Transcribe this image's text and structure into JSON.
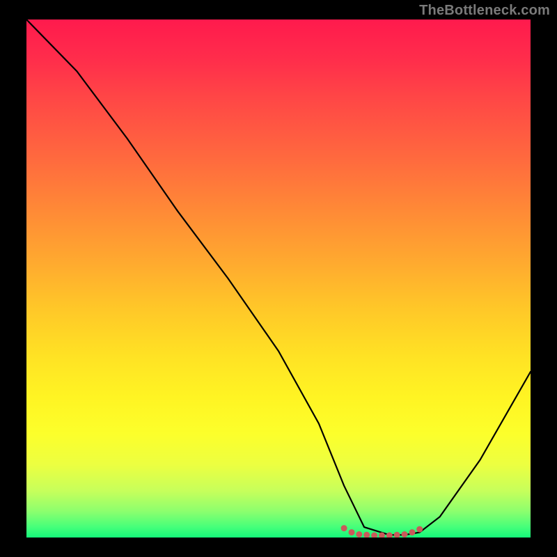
{
  "watermark": "TheBottleneck.com",
  "colors": {
    "frame": "#000000",
    "gradient_top": "#ff1a4d",
    "gradient_bottom": "#14f87a",
    "curve": "#000000",
    "marker": "#c95a5a"
  },
  "chart_data": {
    "type": "line",
    "title": "",
    "xlabel": "",
    "ylabel": "",
    "xlim": [
      0,
      100
    ],
    "ylim": [
      0,
      100
    ],
    "series": [
      {
        "name": "curve",
        "x": [
          0,
          5,
          10,
          20,
          30,
          40,
          50,
          58,
          63,
          67,
          72,
          75,
          78,
          82,
          90,
          100
        ],
        "y": [
          100,
          95,
          90,
          77,
          63,
          50,
          36,
          22,
          10,
          2,
          0.5,
          0.5,
          1,
          4,
          15,
          32
        ]
      }
    ],
    "markers": {
      "name": "bottleneck-range",
      "x": [
        63,
        64.5,
        66,
        67.5,
        69,
        70.5,
        72,
        73.5,
        75,
        76.5,
        78
      ],
      "y": [
        1.8,
        1.0,
        0.6,
        0.5,
        0.4,
        0.4,
        0.4,
        0.5,
        0.6,
        1.0,
        1.6
      ]
    }
  }
}
